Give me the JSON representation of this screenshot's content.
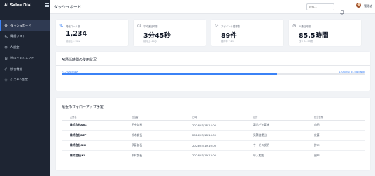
{
  "app": {
    "brand": "AI Sales Dial"
  },
  "sidebar": {
    "items": [
      {
        "label": "ダッシュボード",
        "icon": "home-icon",
        "active": true
      },
      {
        "label": "電話リスト",
        "icon": "phone-icon"
      },
      {
        "label": "AI設定",
        "icon": "ai-settings-icon"
      },
      {
        "label": "社内ドキュメント",
        "icon": "document-icon"
      },
      {
        "label": "統合機能",
        "icon": "link-icon"
      },
      {
        "label": "システム設定",
        "icon": "gear-icon"
      }
    ]
  },
  "header": {
    "title": "ダッシュボード",
    "search_placeholder": "検索...",
    "user_name": "管理者"
  },
  "stats": [
    {
      "label": "発信コール数",
      "value": "1,234",
      "sub": "前月比 +12%",
      "icon": "phone-icon"
    },
    {
      "label": "平均通話時間",
      "value": "3分45秒",
      "sub": "前月比 -10秒",
      "icon": "clock-icon"
    },
    {
      "label": "アポイント獲得数",
      "value": "89件",
      "sub": "獲得率 7.2%",
      "icon": "calendar-check-icon"
    },
    {
      "label": "AI通話時間",
      "value": "85.5時間",
      "sub": "残り 34.5時間",
      "icon": "timer-icon"
    }
  ],
  "usage": {
    "title": "AI通話時間の使用状況",
    "used_label": "71.2% 使用済み",
    "limit_label": "120時間中 85.5時間使用",
    "progress": 0.712,
    "color": "#3b82f6"
  },
  "followups": {
    "title": "最近のフォローアップ予定",
    "columns": [
      "企業名",
      "担当者",
      "日時",
      "目的",
      "担当営業"
    ],
    "rows": [
      [
        "株式会社ABC",
        "田中部長",
        "2024/03/18 14:00",
        "製品デモ実施",
        "山田"
      ],
      [
        "株式会社DEF",
        "鈴木課長",
        "2024/03/18 16:30",
        "見積書提出",
        "佐藤"
      ],
      [
        "株式会社GHI",
        "伊藤部長",
        "2024/03/19 10:00",
        "サービス説明",
        "鈴木"
      ],
      [
        "株式会社JKL",
        "中村課長",
        "2024/03/19 13:00",
        "導入相談",
        "田中"
      ]
    ]
  }
}
